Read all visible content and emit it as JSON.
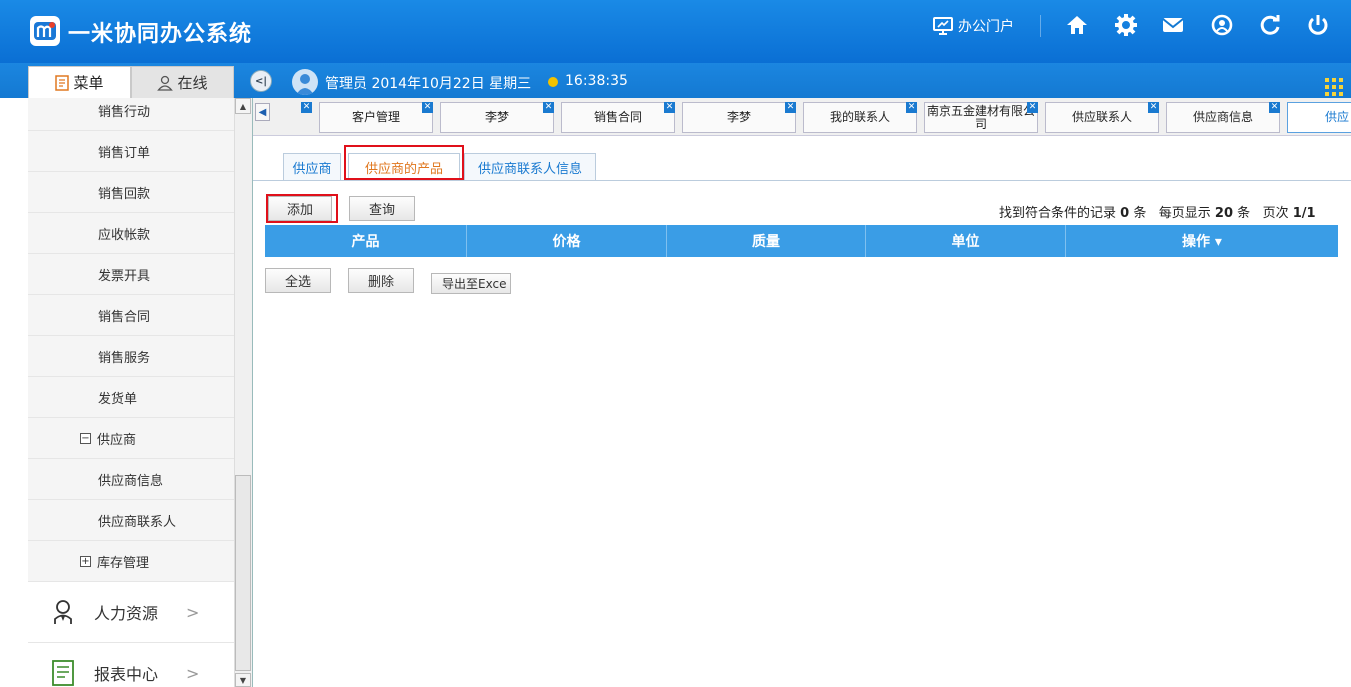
{
  "app": {
    "title": "一米协同办公系统",
    "portal_label": "办公门户"
  },
  "sidebar": {
    "tabs": {
      "menu": "菜单",
      "online": "在线"
    },
    "items": [
      {
        "label": "销售行动",
        "kind": "item"
      },
      {
        "label": "销售订单",
        "kind": "item"
      },
      {
        "label": "销售回款",
        "kind": "item"
      },
      {
        "label": "应收帐款",
        "kind": "item"
      },
      {
        "label": "发票开具",
        "kind": "item"
      },
      {
        "label": "销售合同",
        "kind": "item"
      },
      {
        "label": "销售服务",
        "kind": "item"
      },
      {
        "label": "发货单",
        "kind": "item"
      },
      {
        "label": "供应商",
        "kind": "group-open",
        "toggle": "−"
      },
      {
        "label": "供应商信息",
        "kind": "item"
      },
      {
        "label": "供应商联系人",
        "kind": "item"
      },
      {
        "label": "库存管理",
        "kind": "group-closed",
        "toggle": "+"
      },
      {
        "label": "人力资源",
        "kind": "module"
      },
      {
        "label": "报表中心",
        "kind": "module"
      }
    ]
  },
  "userbar": {
    "user_text": "管理员 2014年10月22日 星期三",
    "time": "16:38:35"
  },
  "page_tabs": [
    {
      "label": "客户管理"
    },
    {
      "label": "李梦"
    },
    {
      "label": "销售合同"
    },
    {
      "label": "李梦"
    },
    {
      "label": "我的联系人"
    },
    {
      "label": "南京五金建材有限公司"
    },
    {
      "label": "供应联系人"
    },
    {
      "label": "供应商信息"
    },
    {
      "label": "供应"
    }
  ],
  "subtabs": [
    {
      "label": "供应商"
    },
    {
      "label": "供应商的产品"
    },
    {
      "label": "供应商联系人信息"
    }
  ],
  "toolbar": {
    "add": "添加",
    "query": "查询"
  },
  "record_info": {
    "prefix": "找到符合条件的记录",
    "count": "0",
    "unit1": "条",
    "per_page_prefix": "每页显示",
    "per_page": "20",
    "unit2": "条",
    "page_prefix": "页次",
    "page": "1/1"
  },
  "grid": {
    "columns": [
      "产品",
      "价格",
      "质量",
      "单位",
      "操作 ▾"
    ]
  },
  "bottom_actions": {
    "select_all": "全选",
    "delete": "删除",
    "export": "导出至Exce"
  },
  "colors": {
    "header_blue": "#0a6fd4",
    "grid_header": "#3a9de6",
    "highlight_red": "#e0101a",
    "active_subtab": "#e07820"
  }
}
